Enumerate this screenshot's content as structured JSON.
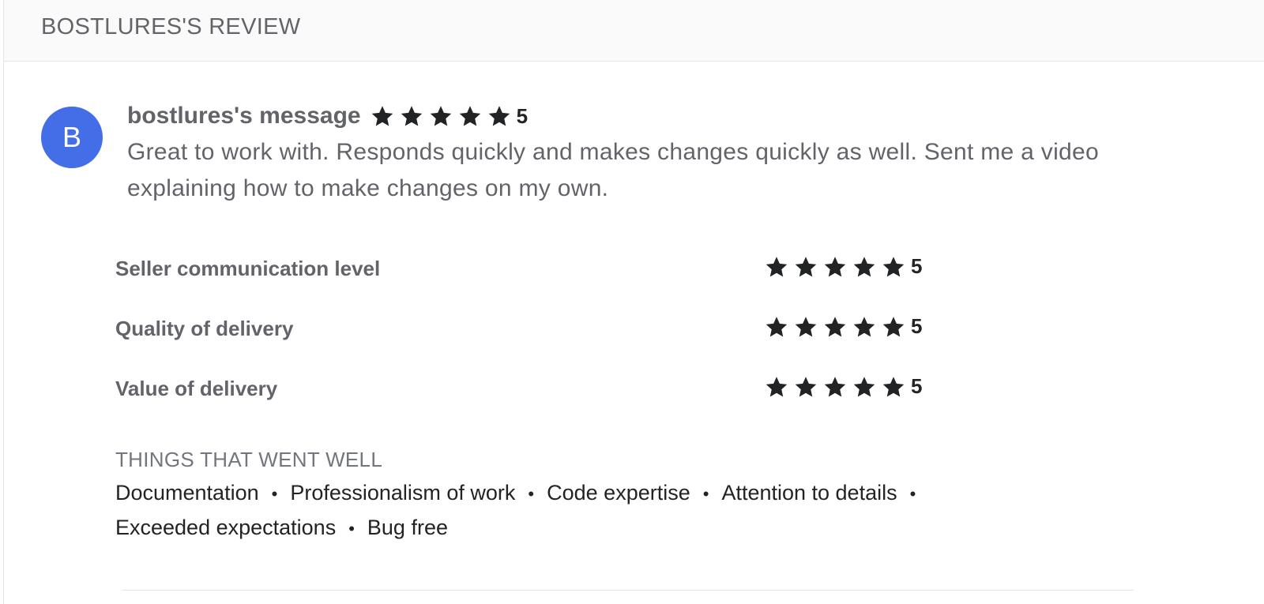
{
  "header": {
    "title": "BOSTLURES'S REVIEW"
  },
  "message": {
    "avatar_letter": "B",
    "avatar_color": "#446ee7",
    "author": "bostlures's message",
    "rating": "5",
    "rating_stars": 5,
    "text": "Great to work with. Responds quickly and makes changes quickly as well. Sent me a video explaining how to make changes on my own."
  },
  "criteria": [
    {
      "label": "Seller communication level",
      "rating": "5",
      "stars": 5
    },
    {
      "label": "Quality of delivery",
      "rating": "5",
      "stars": 5
    },
    {
      "label": "Value of delivery",
      "rating": "5",
      "stars": 5
    }
  ],
  "things_went_well": {
    "title": "THINGS THAT WENT WELL",
    "separator": "•",
    "items": [
      "Documentation",
      "Professionalism of work",
      "Code expertise",
      "Attention to details",
      "Exceeded expectations",
      "Bug free"
    ]
  },
  "colors": {
    "star": "#222325",
    "text_muted": "#62646a",
    "text_dark": "#222325",
    "header_bg": "#fafafa"
  },
  "icons": {
    "star": "star-icon"
  }
}
